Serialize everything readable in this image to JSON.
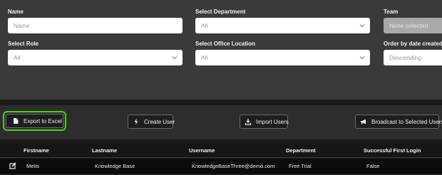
{
  "filters": {
    "name": {
      "label": "Name",
      "placeholder": "Name"
    },
    "department": {
      "label": "Select Department",
      "value": "All"
    },
    "team": {
      "label": "Team",
      "value": "None selected"
    },
    "role": {
      "label": "Select Role",
      "value": "All"
    },
    "office_location": {
      "label": "Select Office Location",
      "value": "All"
    },
    "order_by": {
      "label": "Order by date created",
      "value": "Descending"
    }
  },
  "actions": {
    "export": "Export to Excel",
    "create_user": "Create User",
    "import_users": "Import Users",
    "broadcast": "Broadcast to Selected Users"
  },
  "colors": {
    "highlight": "#46d21f",
    "panel": "#3a3a3a",
    "background": "#1b1b1b"
  },
  "table": {
    "columns": [
      "Firstname",
      "Lastname",
      "Username",
      "Department",
      "Successful First Login"
    ],
    "rows": [
      {
        "firstname": "Metis",
        "lastname": "Knowledge Base",
        "username": "KnowledgeBaseThree@demo.com",
        "department": "Free Trial",
        "first_login": "False"
      }
    ]
  }
}
